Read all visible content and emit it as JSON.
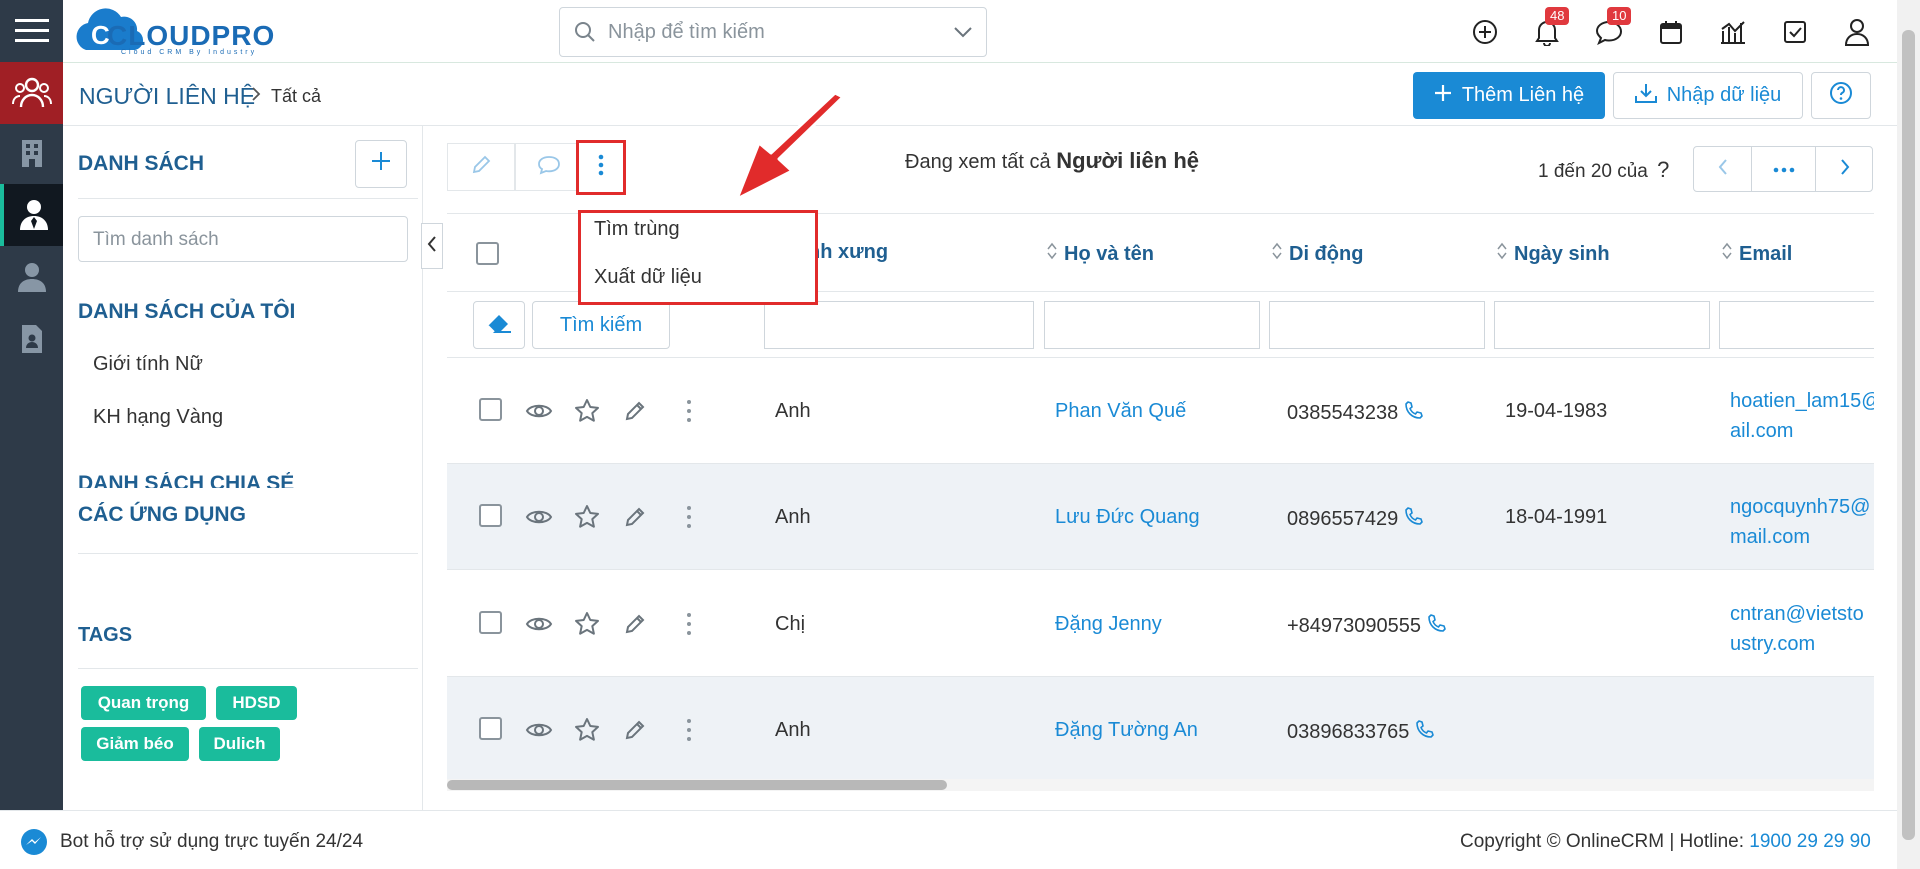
{
  "app": {
    "brand": "CLOUDPRO",
    "brand_tagline": "Cloud CRM By Industry"
  },
  "header": {
    "search_placeholder": "Nhập để tìm kiếm",
    "notification_count": "48",
    "message_count": "10"
  },
  "breadcrumb": {
    "module": "NGƯỜI LIÊN HỆ",
    "current": "Tất cả"
  },
  "actions": {
    "add_contact": "Thêm Liên hệ",
    "import": "Nhập dữ liệu"
  },
  "leftpanel": {
    "list_title": "DANH SÁCH",
    "search_placeholder": "Tìm danh sách",
    "my_lists_title": "DANH SÁCH CỦA TÔI",
    "my_lists": [
      "Giới tính Nữ",
      "KH hạng Vàng"
    ],
    "shared_title": "DANH SÁCH CHIA SẺ",
    "apps_title": "CÁC ỨNG DỤNG",
    "tags_title": "TAGS",
    "tags": [
      "Quan trọng",
      "HDSD",
      "Giảm béo",
      "Dulich"
    ]
  },
  "listview": {
    "viewing_prefix": "Đang xem tất cả",
    "viewing_module": "Người liên hệ",
    "pagination": "1 đến 20 của",
    "pagination_more": "?",
    "search_button": "Tìm kiếm",
    "columns": [
      "nh xưng",
      "Họ và tên",
      "Di động",
      "Ngày sinh",
      "Email"
    ],
    "rows": [
      {
        "salutation": "Anh",
        "name": "Phan Văn Quế",
        "mobile": "0385543238",
        "birthday": "19-04-1983",
        "email1": "hoatien_lam15@",
        "email2": "ail.com"
      },
      {
        "salutation": "Anh",
        "name": "Lưu Đức Quang",
        "mobile": "0896557429",
        "birthday": "18-04-1991",
        "email1": "ngocquynh75@",
        "email2": "mail.com"
      },
      {
        "salutation": "Chị",
        "name": "Đặng Jenny",
        "mobile": "+84973090555",
        "birthday": "",
        "email1": "cntran@vietsto",
        "email2": "ustry.com"
      },
      {
        "salutation": "Anh",
        "name": "Đặng Tường An",
        "mobile": "03896833765",
        "birthday": "",
        "email1": "",
        "email2": ""
      }
    ]
  },
  "more_menu": {
    "items": [
      "Tìm trùng",
      "Xuất dữ liệu"
    ]
  },
  "footer": {
    "bot_text": "Bot hỗ trợ sử dụng trực tuyến 24/24",
    "copyright": "Copyright © OnlineCRM | Hotline:",
    "hotline": "1900 29 29 90"
  },
  "colors": {
    "primary": "#1a8ad5",
    "heading": "#1f5f91",
    "tag": "#1abc9c",
    "highlight": "#e12b2b",
    "rail": "#2e3a48"
  }
}
